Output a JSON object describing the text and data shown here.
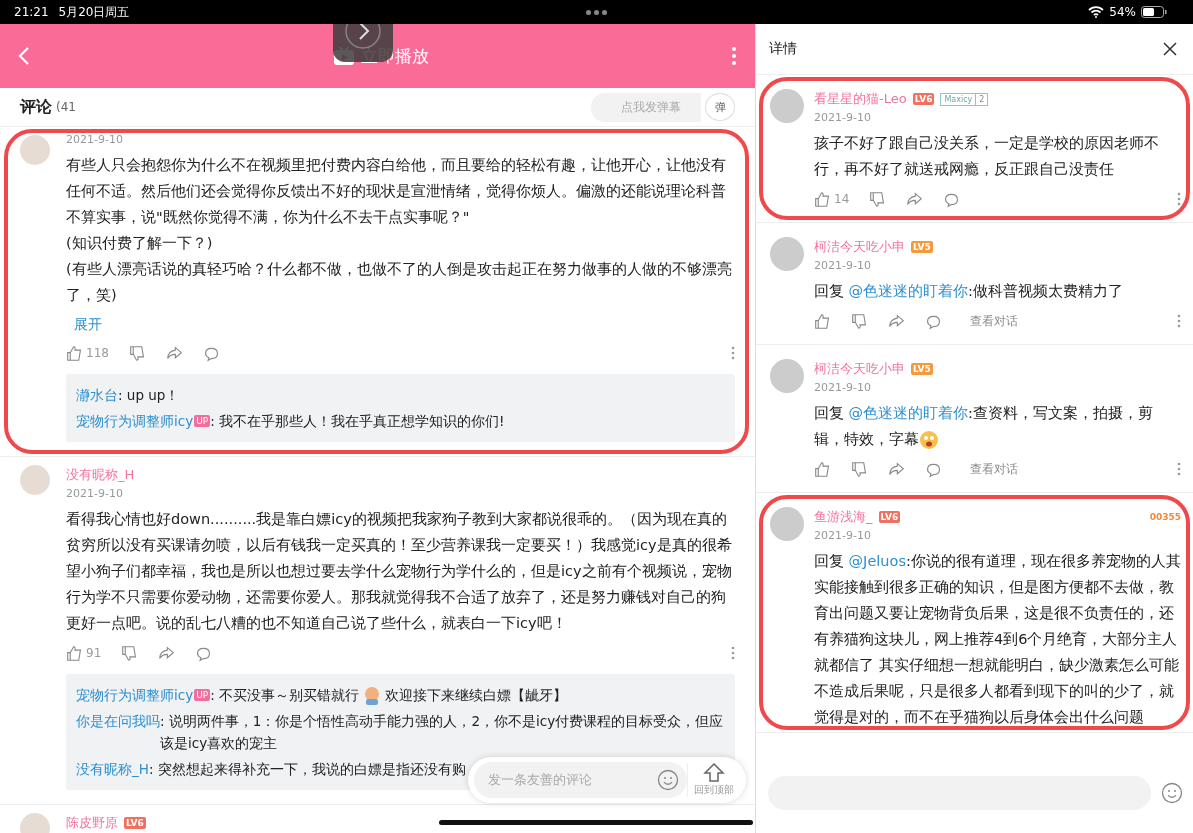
{
  "status_bar": {
    "time": "21:21",
    "date": "5月20日周五",
    "battery": "54%"
  },
  "header": {
    "title": "立即播放"
  },
  "comments_header": {
    "title": "评论",
    "count": "(41",
    "danmaku_placeholder": "点我发弹幕",
    "danmaku_button": "弹"
  },
  "comments": [
    {
      "date": "2021-9-10",
      "circled": true,
      "paragraphs": [
        "有些人只会抱怨你为什么不在视频里把付费内容白给他，而且要给的轻松有趣，让他开心，让他没有任何不适。然后他们还会觉得你反馈出不好的现状是宣泄情绪，觉得你烦人。偏激的还能说理论科普不算实事，说\"既然你觉得不满，你为什么不去干点实事呢？\"",
        "(知识付费了解一下？)",
        "(有些人漂亮话说的真轻巧哈？什么都不做，也做不了的人倒是攻击起正在努力做事的人做的不够漂亮了，笑)"
      ],
      "expand": "展开",
      "likes": "118",
      "replies": [
        {
          "user": "瀞水台",
          "text": ": up up！"
        },
        {
          "user": "宠物行为调整师icy",
          "badge": "UP",
          "text": ": 我不在乎那些人！我在乎真正想学知识的你们!"
        }
      ]
    },
    {
      "user": "没有昵称_H",
      "date": "2021-9-10",
      "paragraphs": [
        "看得我心情也好down..........我是靠白嫖icy的视频把我家狗子教到大家都说很乖的。（因为现在真的贫穷所以没有买课请勿喷，以后有钱我一定买真的！至少营养课我一定要买！）我感觉icy是真的很希望小狗子们都幸福，我也是所以也想过要去学什么宠物行为学什么的，但是icy之前有个视频说，宠物行为学不只需要你爱动物，还需要你爱人。那我就觉得我不合适了放弃了，还是努力赚钱对自己的狗更好一点吧。说的乱七八糟的也不知道自己说了些什么，就表白一下icy吧！"
      ],
      "likes": "91",
      "replies": [
        {
          "user": "宠物行为调整师icy",
          "badge": "UP",
          "text": ": 不买没事～别买错就行",
          "emoji": true,
          "text_after": "欢迎接下来继续白嫖【龇牙】"
        },
        {
          "user": "你是在问我吗",
          "text": ": 说明两件事，1：你是个悟性高动手能力强的人，2，你不是icy付费课程的目标受众，但应该是icy喜欢的宠主"
        },
        {
          "user": "没有昵称_H",
          "text": ": 突然想起来得补充一下，我说的白嫖是指还没有购"
        }
      ]
    },
    {
      "user": "陈皮野原",
      "level": {
        "text": "LV6",
        "color": "#f0715f"
      }
    }
  ],
  "reply_bar": {
    "placeholder": "发一条友善的评论",
    "back_to_top": "回到顶部"
  },
  "detail": {
    "title": "详情",
    "comments": [
      {
        "user": "看星星的猫-Leo",
        "level": {
          "text": "LV6",
          "color": "#f0715f"
        },
        "medal": {
          "name": "Maxicy",
          "rank": "2"
        },
        "date": "2021-9-10",
        "text": "孩子不好了跟自己没关系，一定是学校的原因老师不行，再不好了就送戒网瘾，反正跟自己没责任",
        "likes": "14",
        "circled": true
      },
      {
        "user": "柯洁今天吃小申",
        "level": {
          "text": "LV5",
          "color": "#f59a3b"
        },
        "date": "2021-9-10",
        "reply_to": "@色迷迷的盯着你",
        "prefix": "回复",
        "text": ":做科普视频太费精力了",
        "dialog": "查看对话"
      },
      {
        "user": "柯洁今天吃小申",
        "level": {
          "text": "LV5",
          "color": "#f59a3b"
        },
        "date": "2021-9-10",
        "reply_to": "@色迷迷的盯着你",
        "text": ":查资料，写文案，拍摄，剪辑，特效，字幕",
        "prefix": "回复",
        "emoji": true,
        "dialog": "查看对话"
      },
      {
        "user": "鱼游浅海_",
        "level": {
          "text": "LV6",
          "color": "#f0715f"
        },
        "date": "2021-9-10",
        "reply_to": "@Jeluos",
        "prefix": "回复",
        "text": ":你说的很有道理，现在很多养宠物的人其实能接触到很多正确的知识，但是图方便都不去做，教育出问题又要让宠物背负后果，这是很不负责任的，还有养猫狗这块儿，网上推荐4到6个月绝育，大部分主人就都信了 其实仔细想一想就能明白，缺少激素怎么可能不造成后果呢，只是很多人都看到现下的叫的少了，就觉得是对的，而不在乎猫狗以后身体会出什么问题",
        "garb": "00355",
        "circled": true
      }
    ]
  }
}
